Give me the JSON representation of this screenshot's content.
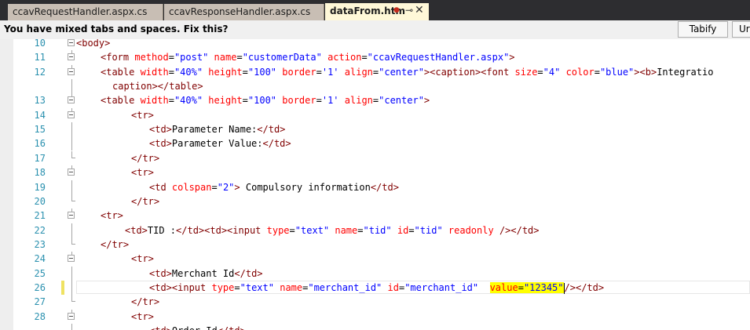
{
  "tabs": [
    {
      "label": "ccavRequestHandler.aspx.cs"
    },
    {
      "label": "ccavResponseHandler.aspx.cs"
    },
    {
      "label": "dataFrom.htm",
      "pin": "⊸",
      "close": "✕"
    }
  ],
  "infobar": {
    "message": "You have mixed tabs and spaces. Fix this?",
    "tabify_label": "Tabify",
    "untabify_label": "Ur"
  },
  "editor": {
    "lines": [
      {
        "num": "10",
        "fold": "box",
        "segs": [
          [
            "tg",
            "<body>"
          ]
        ]
      },
      {
        "num": "11",
        "fold": "box",
        "segs": [
          [
            "tg",
            "<form "
          ],
          [
            "at",
            "method"
          ],
          [
            "tx",
            "="
          ],
          [
            "av",
            "\"post\""
          ],
          [
            "tx",
            " "
          ],
          [
            "at",
            "name"
          ],
          [
            "tx",
            "="
          ],
          [
            "av",
            "\"customerData\""
          ],
          [
            "tx",
            " "
          ],
          [
            "at",
            "action"
          ],
          [
            "tx",
            "="
          ],
          [
            "av",
            "\"ccavRequestHandler.aspx\""
          ],
          [
            "tg",
            ">"
          ]
        ]
      },
      {
        "num": "12",
        "fold": "box",
        "segs": [
          [
            "tg",
            "<table "
          ],
          [
            "at",
            "width"
          ],
          [
            "tx",
            "="
          ],
          [
            "av",
            "\"40%\""
          ],
          [
            "tx",
            " "
          ],
          [
            "at",
            "height"
          ],
          [
            "tx",
            "="
          ],
          [
            "av",
            "\"100\""
          ],
          [
            "tx",
            " "
          ],
          [
            "at",
            "border"
          ],
          [
            "tx",
            "="
          ],
          [
            "av",
            "'1'"
          ],
          [
            "tx",
            " "
          ],
          [
            "at",
            "align"
          ],
          [
            "tx",
            "="
          ],
          [
            "av",
            "\"center\""
          ],
          [
            "tg",
            "><caption><font "
          ],
          [
            "at",
            "size"
          ],
          [
            "tx",
            "="
          ],
          [
            "av",
            "\"4\""
          ],
          [
            "tx",
            " "
          ],
          [
            "at",
            "color"
          ],
          [
            "tx",
            "="
          ],
          [
            "av",
            "\"blue\""
          ],
          [
            "tg",
            "><b>"
          ],
          [
            "tx",
            "Integratio"
          ]
        ]
      },
      {
        "num": "",
        "fold": "",
        "segs": [
          [
            "tg",
            "caption></table>"
          ]
        ]
      },
      {
        "num": "13",
        "fold": "box",
        "segs": [
          [
            "tg",
            "<table "
          ],
          [
            "at",
            "width"
          ],
          [
            "tx",
            "="
          ],
          [
            "av",
            "\"40%\""
          ],
          [
            "tx",
            " "
          ],
          [
            "at",
            "height"
          ],
          [
            "tx",
            "="
          ],
          [
            "av",
            "\"100\""
          ],
          [
            "tx",
            " "
          ],
          [
            "at",
            "border"
          ],
          [
            "tx",
            "="
          ],
          [
            "av",
            "'1'"
          ],
          [
            "tx",
            " "
          ],
          [
            "at",
            "align"
          ],
          [
            "tx",
            "="
          ],
          [
            "av",
            "\"center\""
          ],
          [
            "tg",
            ">"
          ]
        ]
      },
      {
        "num": "14",
        "fold": "box",
        "segs": [
          [
            "tg",
            "<tr>"
          ]
        ]
      },
      {
        "num": "15",
        "fold": "line",
        "segs": [
          [
            "tg",
            "<td>"
          ],
          [
            "tx",
            "Parameter Name:"
          ],
          [
            "tg",
            "</td>"
          ]
        ]
      },
      {
        "num": "16",
        "fold": "line",
        "segs": [
          [
            "tg",
            "<td>"
          ],
          [
            "tx",
            "Parameter Value:"
          ],
          [
            "tg",
            "</td>"
          ]
        ]
      },
      {
        "num": "17",
        "fold": "end",
        "segs": [
          [
            "tg",
            "</tr>"
          ]
        ]
      },
      {
        "num": "18",
        "fold": "box",
        "segs": [
          [
            "tg",
            "<tr>"
          ]
        ]
      },
      {
        "num": "19",
        "fold": "line",
        "segs": [
          [
            "tg",
            "<td "
          ],
          [
            "at",
            "colspan"
          ],
          [
            "tx",
            "="
          ],
          [
            "av",
            "\"2\""
          ],
          [
            "tg",
            ">"
          ],
          [
            "tx",
            " Compulsory information"
          ],
          [
            "tg",
            "</td>"
          ]
        ]
      },
      {
        "num": "20",
        "fold": "end",
        "segs": [
          [
            "tg",
            "</tr>"
          ]
        ]
      },
      {
        "num": "21",
        "fold": "box",
        "segs": [
          [
            "tg",
            "<tr>"
          ]
        ]
      },
      {
        "num": "22",
        "fold": "line",
        "segs": [
          [
            "tg",
            "<td>"
          ],
          [
            "tx",
            "TID :"
          ],
          [
            "tg",
            "</td><td><input "
          ],
          [
            "at",
            "type"
          ],
          [
            "tx",
            "="
          ],
          [
            "av",
            "\"text\""
          ],
          [
            "tx",
            " "
          ],
          [
            "at",
            "name"
          ],
          [
            "tx",
            "="
          ],
          [
            "av",
            "\"tid\""
          ],
          [
            "tx",
            " "
          ],
          [
            "at",
            "id"
          ],
          [
            "tx",
            "="
          ],
          [
            "av",
            "\"tid\""
          ],
          [
            "tx",
            " "
          ],
          [
            "at",
            "readonly"
          ],
          [
            "tx",
            " "
          ],
          [
            "tg",
            "/></td>"
          ]
        ]
      },
      {
        "num": "23",
        "fold": "end",
        "segs": [
          [
            "tg",
            "</tr>"
          ]
        ]
      },
      {
        "num": "24",
        "fold": "box",
        "segs": [
          [
            "tg",
            "<tr>"
          ]
        ]
      },
      {
        "num": "25",
        "fold": "line",
        "segs": [
          [
            "tg",
            "<td>"
          ],
          [
            "tx",
            "Merchant Id"
          ],
          [
            "tg",
            "</td>"
          ]
        ]
      },
      {
        "num": "26",
        "fold": "line",
        "current": true,
        "segs": [
          [
            "tg",
            "<td><input "
          ],
          [
            "at",
            "type"
          ],
          [
            "tx",
            "="
          ],
          [
            "av",
            "\"text\""
          ],
          [
            "tx",
            " "
          ],
          [
            "at",
            "name"
          ],
          [
            "tx",
            "="
          ],
          [
            "av",
            "\"merchant_id\""
          ],
          [
            "tx",
            " "
          ],
          [
            "at",
            "id"
          ],
          [
            "tx",
            "="
          ],
          [
            "av",
            "\"merchant_id\""
          ],
          [
            "tx",
            "  "
          ],
          [
            "hl_at",
            "value"
          ],
          [
            "hl_tx",
            "="
          ],
          [
            "hl_av",
            "\"12345\""
          ],
          [
            "caret",
            ""
          ],
          [
            "tg",
            "/></td>"
          ]
        ]
      },
      {
        "num": "27",
        "fold": "end",
        "segs": [
          [
            "tg",
            "</tr>"
          ]
        ]
      },
      {
        "num": "28",
        "fold": "box",
        "segs": [
          [
            "tg",
            "<tr>"
          ]
        ]
      },
      {
        "num": "",
        "fold": "line",
        "segs": [
          [
            "tg",
            "<td>"
          ],
          [
            "tx",
            "Order Id"
          ],
          [
            "tg",
            "</td>"
          ]
        ]
      }
    ]
  },
  "colors": {
    "tag": "#800000",
    "attribute": "#ff0000",
    "value": "#0000ff",
    "line_number": "#2b91af",
    "highlight": "#ffff00",
    "change_marker": "#efe262",
    "tab_active": "#fff8d8",
    "tab_inactive": "#c8beb4"
  }
}
